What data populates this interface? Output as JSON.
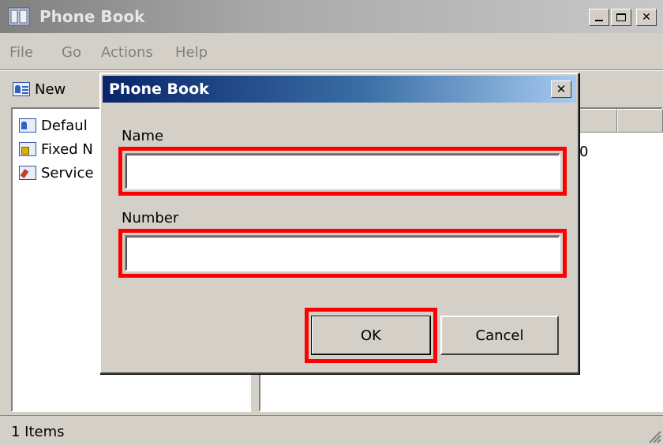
{
  "main_window": {
    "title": "Phone Book",
    "menu": [
      "File",
      "Go",
      "Actions",
      "Help"
    ],
    "toolbar": {
      "new_label": "New"
    },
    "tree": [
      {
        "label": "Defaul",
        "icon": "contact-card-icon"
      },
      {
        "label": "Fixed N",
        "icon": "lock-card-icon"
      },
      {
        "label": "Service",
        "icon": "service-card-icon"
      }
    ],
    "list_fragment": "0",
    "status": "1 Items"
  },
  "dialog": {
    "title": "Phone Book",
    "close_glyph": "✕",
    "name_label": "Name",
    "name_value": "",
    "number_label": "Number",
    "number_value": "",
    "ok_label": "OK",
    "cancel_label": "Cancel"
  },
  "colors": {
    "highlight": "#ff0000",
    "dialog_title_start": "#0a246a",
    "dialog_title_end": "#a6caf0"
  }
}
